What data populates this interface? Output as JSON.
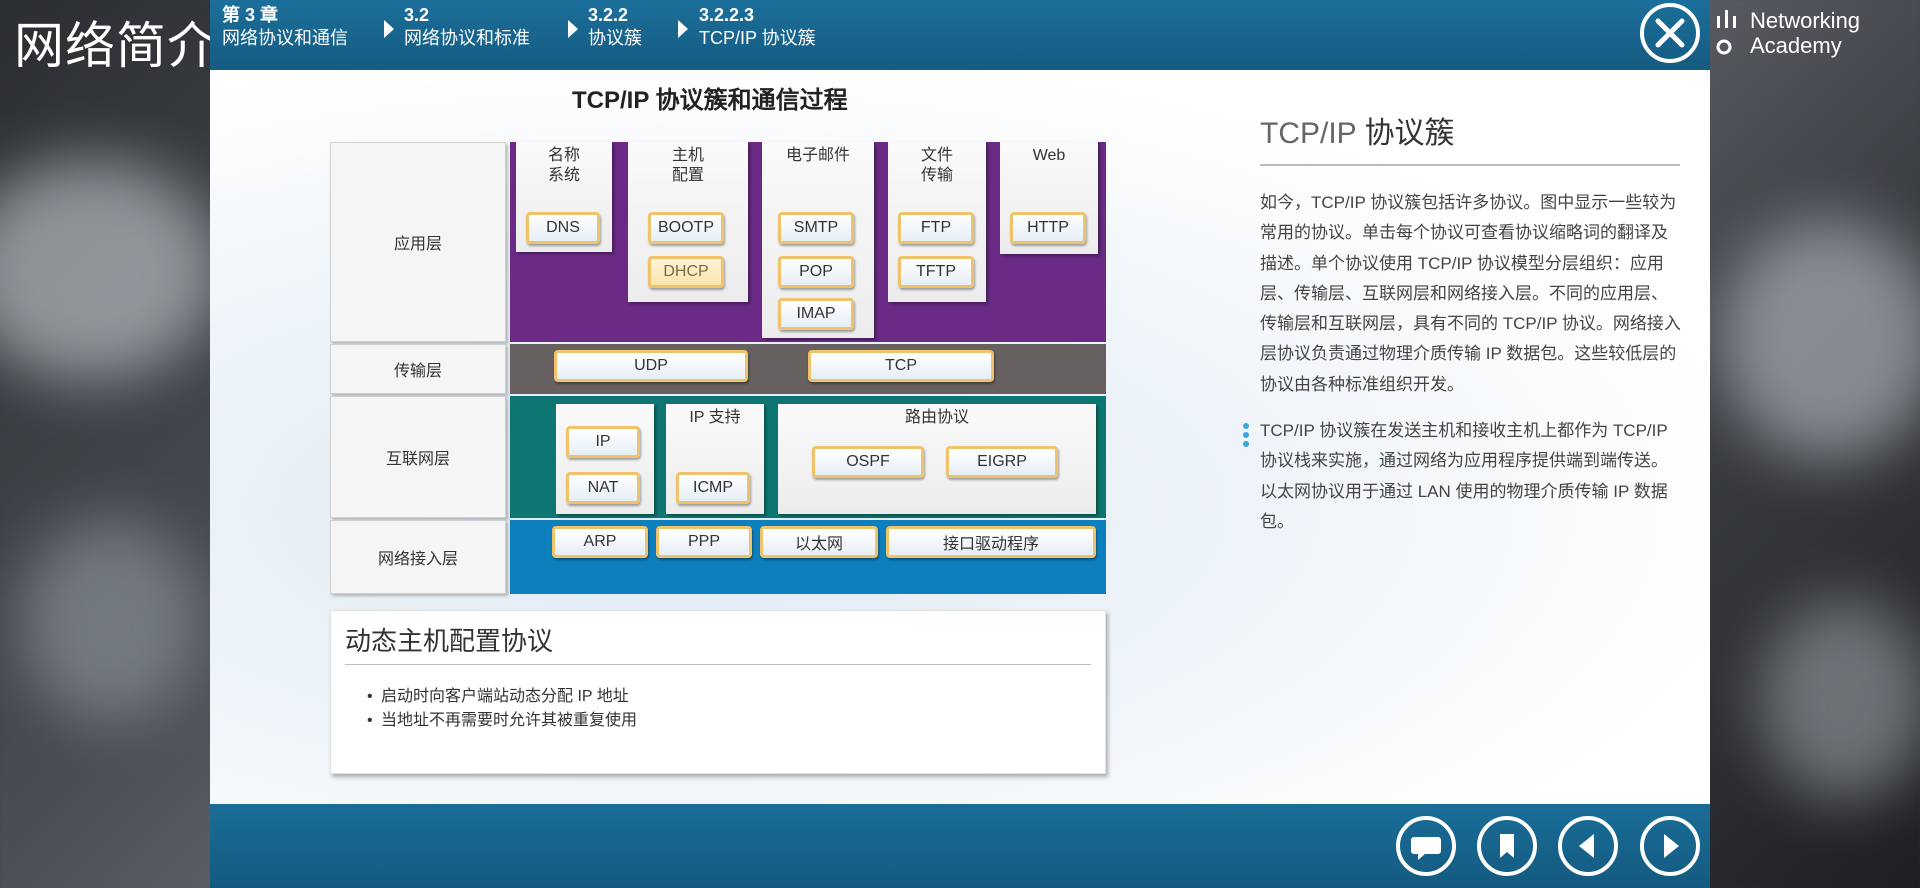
{
  "page": {
    "course_title": "网络简介"
  },
  "logo": {
    "line1": "Networking",
    "line2": "Academy"
  },
  "breadcrumbs": [
    {
      "num": "第 3 章",
      "label": "网络协议和通信"
    },
    {
      "num": "3.2",
      "label": "网络协议和标准"
    },
    {
      "num": "3.2.2",
      "label": "协议簇"
    },
    {
      "num": "3.2.2.3",
      "label": "TCP/IP 协议簇"
    }
  ],
  "icons": {
    "close": "close-icon",
    "comment": "comment-icon",
    "bookmark": "bookmark-icon",
    "prev": "prev-icon",
    "next": "next-icon"
  },
  "colors": {
    "application_layer": "#6a2a86",
    "transport_layer": "#666060",
    "internet_layer": "#0e7672",
    "network_access_layer": "#0d7fbd",
    "protocol_border": "#f0c36a",
    "bar": "#1a6d98"
  },
  "diagram": {
    "title": "TCP/IP 协议簇和通信过程",
    "layers": {
      "application": "应用层",
      "transport": "传输层",
      "internet": "互联网层",
      "network_access": "网络接入层"
    },
    "app_groups": {
      "name_system": "名称\n系统",
      "host_config": "主机\n配置",
      "email": "电子邮件",
      "file_transfer": "文件\n传输",
      "web": "Web"
    },
    "protocols": {
      "dns": "DNS",
      "bootp": "BOOTP",
      "dhcp": "DHCP",
      "smtp": "SMTP",
      "pop": "POP",
      "imap": "IMAP",
      "ftp": "FTP",
      "tftp": "TFTP",
      "http": "HTTP",
      "udp": "UDP",
      "tcp": "TCP",
      "ip": "IP",
      "nat": "NAT",
      "icmp": "ICMP",
      "ospf": "OSPF",
      "eigrp": "EIGRP",
      "arp": "ARP",
      "ppp": "PPP",
      "ethernet": "以太网",
      "driver": "接口驱动程序"
    },
    "internet_groups": {
      "ip_support": "IP 支持",
      "routing": "路由协议"
    },
    "selected_protocol": "DHCP"
  },
  "description": {
    "title": "动态主机配置协议",
    "bullets": [
      "启动时向客户端站动态分配 IP 地址",
      "当地址不再需要时允许其被重复使用"
    ]
  },
  "side": {
    "title_prefix": "TCP/IP",
    "title_suffix": "协议簇",
    "para1": "如今，TCP/IP 协议簇包括许多协议。图中显示一些较为常用的协议。单击每个协议可查看协议缩略词的翻译及描述。单个协议使用 TCP/IP 协议模型分层组织：应用层、传输层、互联网层和网络接入层。不同的应用层、传输层和互联网层，具有不同的 TCP/IP 协议。网络接入层协议负责通过物理介质传输 IP 数据包。这些较低层的协议由各种标准组织开发。",
    "para2": "TCP/IP 协议簇在发送主机和接收主机上都作为 TCP/IP 协议栈来实施，通过网络为应用程序提供端到端传送。以太网协议用于通过 LAN 使用的物理介质传输 IP 数据包。"
  }
}
